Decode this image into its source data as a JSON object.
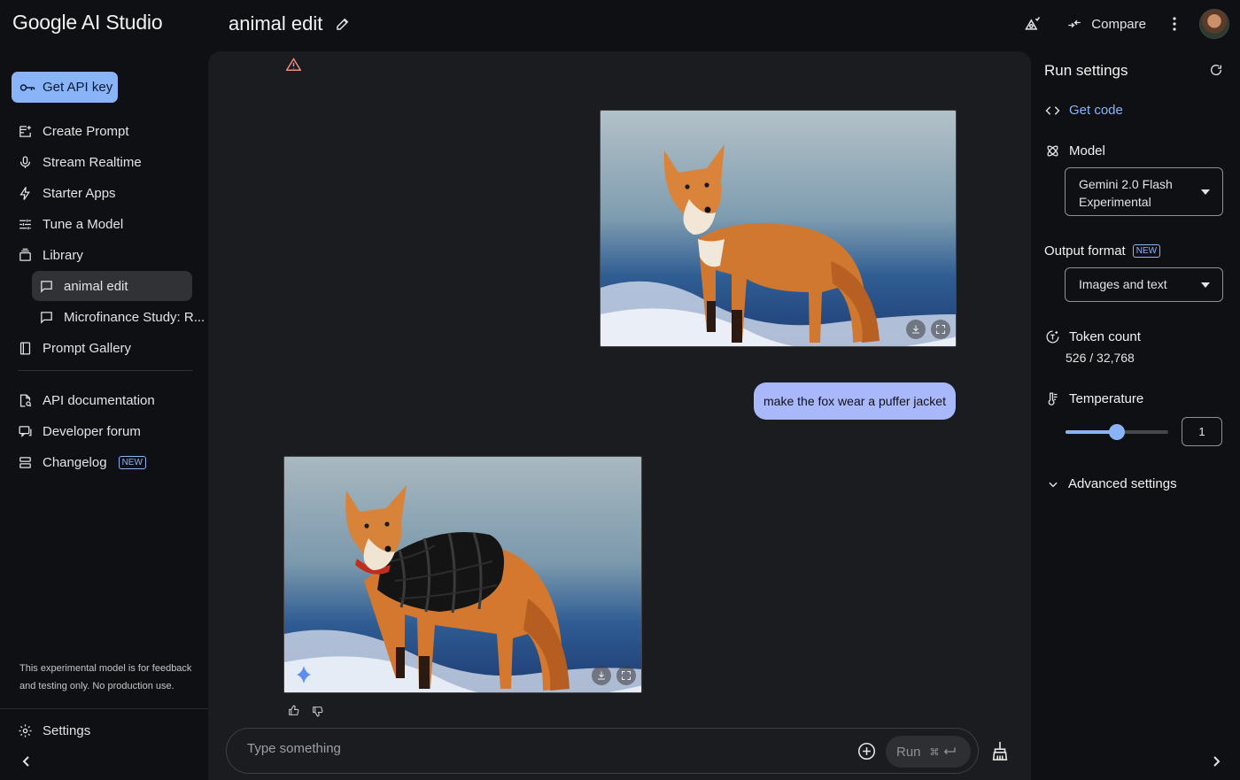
{
  "header": {
    "brand": "Google AI Studio",
    "doc_title": "animal edit",
    "compare_label": "Compare"
  },
  "sidebar": {
    "api_key_label": "Get API key",
    "items": [
      {
        "label": "Create Prompt",
        "icon": "create-prompt-icon"
      },
      {
        "label": "Stream Realtime",
        "icon": "mic-icon"
      },
      {
        "label": "Starter Apps",
        "icon": "bolt-icon"
      },
      {
        "label": "Tune a Model",
        "icon": "tune-icon"
      },
      {
        "label": "Library",
        "icon": "library-icon"
      }
    ],
    "library_items": [
      {
        "label": "animal edit",
        "active": true
      },
      {
        "label": "Microfinance Study: R...",
        "active": false
      }
    ],
    "prompt_gallery": "Prompt Gallery",
    "resources": [
      {
        "label": "API documentation"
      },
      {
        "label": "Developer forum"
      },
      {
        "label": "Changelog",
        "badge": "NEW"
      }
    ],
    "disclaimer": "This experimental model is for feedback and testing only. No production use.",
    "settings_label": "Settings"
  },
  "chat": {
    "user_message": "make the fox wear a puffer jacket",
    "input_placeholder": "Type something",
    "run_label": "Run"
  },
  "run_settings": {
    "title": "Run settings",
    "get_code": "Get code",
    "model_label": "Model",
    "model_value": "Gemini 2.0 Flash Experimental",
    "output_format_label": "Output format",
    "output_format_badge": "NEW",
    "output_format_value": "Images and text",
    "token_count_label": "Token count",
    "token_count_value": "526 / 32,768",
    "temperature_label": "Temperature",
    "temperature_value": "1",
    "temperature_fraction": 0.5,
    "advanced_label": "Advanced settings"
  },
  "colors": {
    "accent": "#8ab4f8",
    "user_bubble": "#a8b8fb",
    "background": "#0e1013",
    "panel": "#1b1c1f"
  }
}
